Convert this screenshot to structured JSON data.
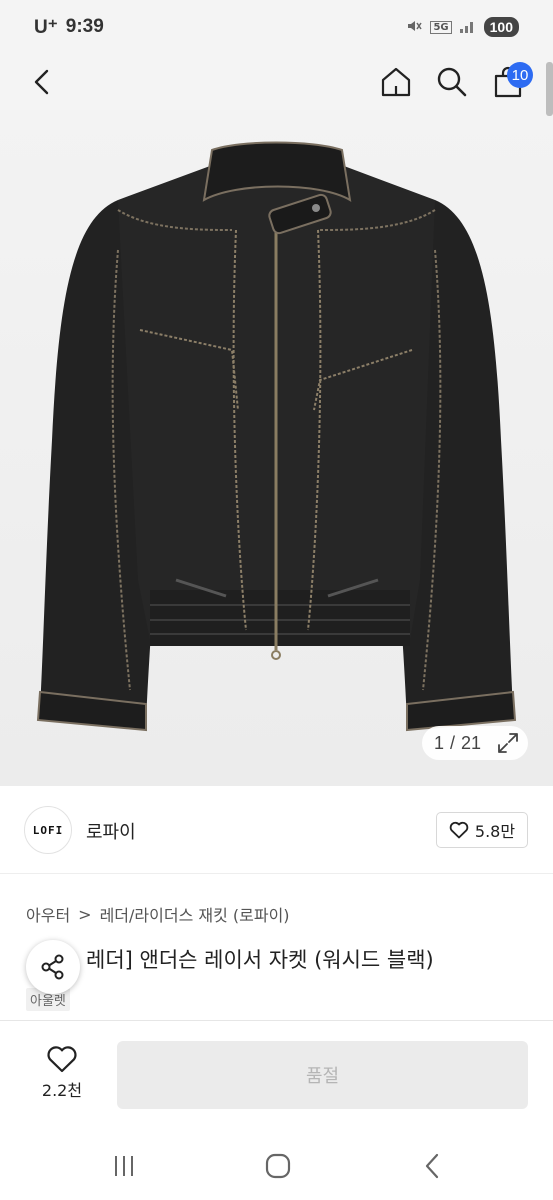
{
  "status_bar": {
    "carrier": "U⁺",
    "time": "9:39",
    "network": "5G",
    "battery": "100"
  },
  "header": {
    "cart_count": "10"
  },
  "gallery": {
    "current": "1",
    "separator": "/",
    "total": "21"
  },
  "brand": {
    "logo_text": "LOFI",
    "name": "로파이",
    "likes": "5.8만"
  },
  "breadcrumb": {
    "level1": "아우터",
    "separator": ">",
    "level2": "레더/라이더스 재킷 (로파이)"
  },
  "product": {
    "title": "레더] 앤더슨 레이서 자켓 (워시드 블랙)",
    "tag": "아울렛"
  },
  "bottom_bar": {
    "wish_count": "2.2천",
    "cta_label": "품절"
  },
  "colors": {
    "accent": "#2d6bf2",
    "disabled_bg": "#ebebeb",
    "disabled_text": "#b5b5b5"
  }
}
